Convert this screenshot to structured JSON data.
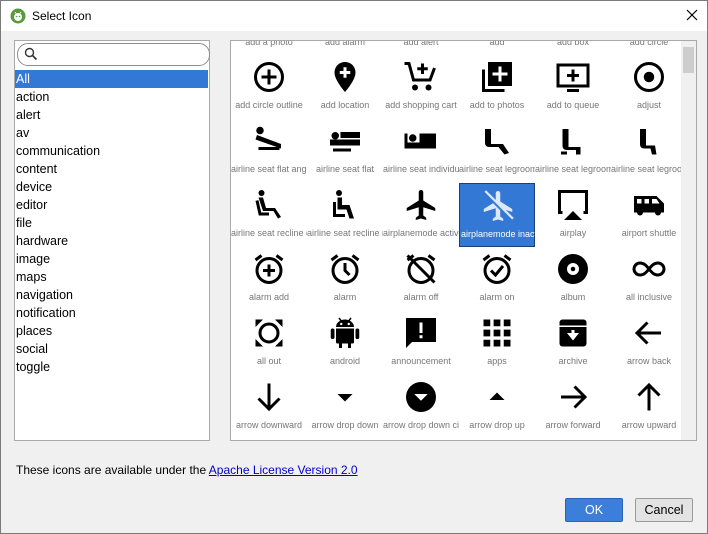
{
  "window": {
    "title": "Select Icon",
    "app_icon": "android-studio-icon",
    "close_icon": "close-icon"
  },
  "search": {
    "placeholder": "",
    "value": "",
    "icon": "search-icon"
  },
  "categories": [
    {
      "label": "All",
      "selected": true
    },
    {
      "label": "action"
    },
    {
      "label": "alert"
    },
    {
      "label": "av"
    },
    {
      "label": "communication"
    },
    {
      "label": "content"
    },
    {
      "label": "device"
    },
    {
      "label": "editor"
    },
    {
      "label": "file"
    },
    {
      "label": "hardware"
    },
    {
      "label": "image"
    },
    {
      "label": "maps"
    },
    {
      "label": "navigation"
    },
    {
      "label": "notification"
    },
    {
      "label": "places"
    },
    {
      "label": "social"
    },
    {
      "label": "toggle"
    }
  ],
  "partial_row_labels": [
    "add a photo",
    "add alarm",
    "add alert",
    "add",
    "add box",
    "add circle"
  ],
  "icons": [
    {
      "label": "add circle outline",
      "icon": "add-circle-outline-icon"
    },
    {
      "label": "add location",
      "icon": "add-location-icon"
    },
    {
      "label": "add shopping cart",
      "icon": "add-shopping-cart-icon"
    },
    {
      "label": "add to photos",
      "icon": "add-to-photos-icon"
    },
    {
      "label": "add to queue",
      "icon": "add-to-queue-icon"
    },
    {
      "label": "adjust",
      "icon": "adjust-icon"
    },
    {
      "label": "airline seat flat angled",
      "icon": "airline-seat-flat-angled-icon"
    },
    {
      "label": "airline seat flat",
      "icon": "airline-seat-flat-icon"
    },
    {
      "label": "airline seat individual suite",
      "icon": "airline-seat-individual-suite-icon"
    },
    {
      "label": "airline seat legroom extra",
      "icon": "airline-seat-legroom-extra-icon"
    },
    {
      "label": "airline seat legroom normal",
      "icon": "airline-seat-legroom-normal-icon"
    },
    {
      "label": "airline seat legroom reduced",
      "icon": "airline-seat-legroom-reduced-icon"
    },
    {
      "label": "airline seat recline extra",
      "icon": "airline-seat-recline-extra-icon"
    },
    {
      "label": "airline seat recline normal",
      "icon": "airline-seat-recline-normal-icon"
    },
    {
      "label": "airplanemode active",
      "icon": "airplanemode-active-icon"
    },
    {
      "label": "airplanemode inactive",
      "icon": "airplanemode-inactive-icon",
      "selected": true
    },
    {
      "label": "airplay",
      "icon": "airplay-icon"
    },
    {
      "label": "airport shuttle",
      "icon": "airport-shuttle-icon"
    },
    {
      "label": "alarm add",
      "icon": "alarm-add-icon"
    },
    {
      "label": "alarm",
      "icon": "alarm-icon"
    },
    {
      "label": "alarm off",
      "icon": "alarm-off-icon"
    },
    {
      "label": "alarm on",
      "icon": "alarm-on-icon"
    },
    {
      "label": "album",
      "icon": "album-icon"
    },
    {
      "label": "all inclusive",
      "icon": "all-inclusive-icon"
    },
    {
      "label": "all out",
      "icon": "all-out-icon"
    },
    {
      "label": "android",
      "icon": "android-icon"
    },
    {
      "label": "announcement",
      "icon": "announcement-icon"
    },
    {
      "label": "apps",
      "icon": "apps-icon"
    },
    {
      "label": "archive",
      "icon": "archive-icon"
    },
    {
      "label": "arrow back",
      "icon": "arrow-back-icon"
    },
    {
      "label": "arrow downward",
      "icon": "arrow-downward-icon"
    },
    {
      "label": "arrow drop down",
      "icon": "arrow-drop-down-icon"
    },
    {
      "label": "arrow drop down circle",
      "icon": "arrow-drop-down-circle-icon"
    },
    {
      "label": "arrow drop up",
      "icon": "arrow-drop-up-icon"
    },
    {
      "label": "arrow forward",
      "icon": "arrow-forward-icon"
    },
    {
      "label": "arrow upward",
      "icon": "arrow-upward-icon"
    }
  ],
  "footer": {
    "license_prefix": "These icons are available under the ",
    "license_link": "Apache License Version 2.0"
  },
  "buttons": {
    "ok": "OK",
    "cancel": "Cancel"
  },
  "colors": {
    "selection": "#3478d6",
    "link": "#0000cc",
    "ok_button": "#3c7fdb"
  }
}
